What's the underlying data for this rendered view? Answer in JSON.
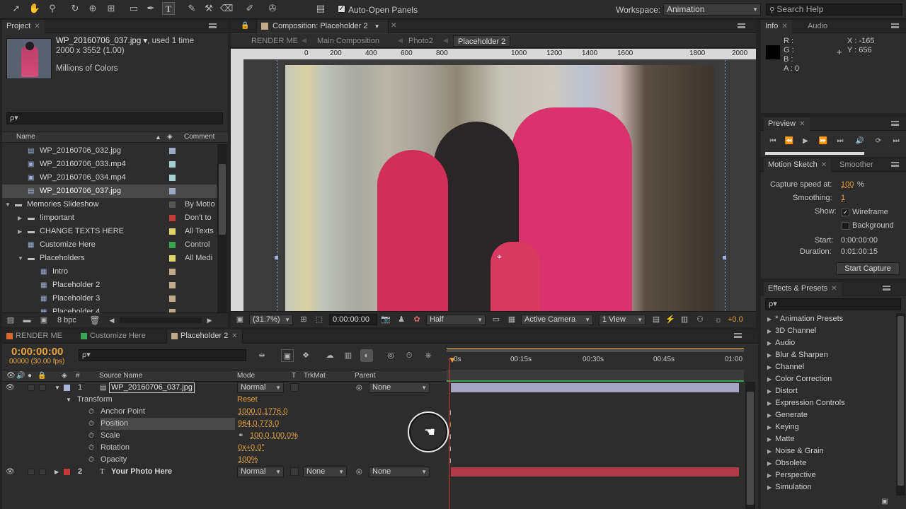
{
  "toolbar": {
    "auto_open_panels": "Auto-Open Panels",
    "workspace_label": "Workspace:",
    "workspace_value": "Animation",
    "search_placeholder": "Search Help"
  },
  "project": {
    "tab": "Project",
    "file_name": "WP_20160706_037.jpg ▾",
    "used": ", used 1 time",
    "dimensions": "2000 x 3552 (1.00)",
    "colors": "Millions of Colors",
    "search_placeholder": "ρ▾",
    "col_name": "Name",
    "col_comment": "Comment",
    "items": [
      {
        "name": "WP_20160706_032.jpg",
        "comment": "",
        "color": "#9aa9c4",
        "indent": 1,
        "type": "image"
      },
      {
        "name": "WP_20160706_033.mp4",
        "comment": "",
        "color": "#a6cfd0",
        "indent": 1,
        "type": "video"
      },
      {
        "name": "WP_20160706_034.mp4",
        "comment": "",
        "color": "#a6cfd0",
        "indent": 1,
        "type": "video"
      },
      {
        "name": "WP_20160706_037.jpg",
        "comment": "",
        "color": "#9aa9c4",
        "indent": 1,
        "type": "image",
        "selected": true
      },
      {
        "name": "Memories Slideshow",
        "comment": "By Motio",
        "color": "#555555",
        "indent": 0,
        "type": "folder",
        "expanded": true
      },
      {
        "name": "!important",
        "comment": "Don't to",
        "color": "#c03c3c",
        "indent": 1,
        "type": "folder"
      },
      {
        "name": "CHANGE TEXTS HERE",
        "comment": "All Texts",
        "color": "#e2d36a",
        "indent": 1,
        "type": "folder"
      },
      {
        "name": "Customize Here",
        "comment": "Control",
        "color": "#3aa651",
        "indent": 1,
        "type": "comp"
      },
      {
        "name": "Placeholders",
        "comment": "All Medi",
        "color": "#e2d36a",
        "indent": 1,
        "type": "folder",
        "expanded": true
      },
      {
        "name": "Intro",
        "comment": "",
        "color": "#c2a98a",
        "indent": 2,
        "type": "comp"
      },
      {
        "name": "Placeholder 2",
        "comment": "",
        "color": "#c2a98a",
        "indent": 2,
        "type": "comp"
      },
      {
        "name": "Placeholder 3",
        "comment": "",
        "color": "#c2a98a",
        "indent": 2,
        "type": "comp"
      },
      {
        "name": "Placeholder 4",
        "comment": "",
        "color": "#c2a98a",
        "indent": 2,
        "type": "comp"
      }
    ],
    "bpc": "8 bpc"
  },
  "composition": {
    "tab": "Composition: Placeholder 2",
    "breadcrumbs": [
      "RENDER ME",
      "Main Composition",
      "Photo2",
      "Placeholder 2"
    ],
    "ruler": [
      "0",
      "200",
      "400",
      "600",
      "800",
      "1000",
      "1200",
      "1400",
      "1600",
      "1800",
      "2000"
    ],
    "zoom": "(31.7%)",
    "timecode": "0:00:00:00",
    "resolution": "Half",
    "camera": "Active Camera",
    "views": "1 View",
    "exposure": "+0.0"
  },
  "info": {
    "tab": "Info",
    "tab2": "Audio",
    "r": "R :",
    "g": "G :",
    "b": "B :",
    "a": "A : 0",
    "x": "X : -165",
    "y": "Y : 656"
  },
  "preview": {
    "tab": "Preview"
  },
  "motion_sketch": {
    "tab": "Motion Sketch",
    "tab2": "Smoother",
    "capture_label": "Capture speed at:",
    "capture_value": "100",
    "capture_unit": "%",
    "smoothing_label": "Smoothing:",
    "smoothing_value": "1",
    "show_label": "Show:",
    "wireframe": "Wireframe",
    "background": "Background",
    "start_label": "Start:",
    "start_value": "0:00:00:00",
    "duration_label": "Duration:",
    "duration_value": "0:01:00:15",
    "start_capture": "Start Capture"
  },
  "effects": {
    "tab": "Effects & Presets",
    "search_placeholder": "ρ▾",
    "items": [
      "* Animation Presets",
      "3D Channel",
      "Audio",
      "Blur & Sharpen",
      "Channel",
      "Color Correction",
      "Distort",
      "Expression Controls",
      "Generate",
      "Keying",
      "Matte",
      "Noise & Grain",
      "Obsolete",
      "Perspective",
      "Simulation"
    ]
  },
  "timeline": {
    "tabs": [
      {
        "label": "RENDER ME",
        "color": "#d9682f"
      },
      {
        "label": "Customize Here",
        "color": "#3aa651"
      },
      {
        "label": "Placeholder 2",
        "color": "#c2a98a"
      }
    ],
    "timecode": "0:00:00:00",
    "frames": "00000 (30.00 fps)",
    "search_placeholder": "ρ▾",
    "cols": {
      "source": "Source Name",
      "mode": "Mode",
      "t": "T",
      "trkmat": "TrkMat",
      "parent": "Parent"
    },
    "ruler": [
      "0s",
      "00:15s",
      "00:30s",
      "00:45s",
      "01:00"
    ],
    "layers": [
      {
        "num": "1",
        "name": "WP_20160706_037.jpg",
        "mode": "Normal",
        "trkmat": "",
        "parent": "None",
        "color": "#a8b4d8"
      },
      {
        "num": "2",
        "name": "Your Photo Here",
        "mode": "Normal",
        "trkmat": "None",
        "parent": "None",
        "color": "#c43a3a"
      }
    ],
    "transform": {
      "label": "Transform",
      "reset": "Reset",
      "props": [
        {
          "name": "Anchor Point",
          "value": "1000.0,1776.0"
        },
        {
          "name": "Position",
          "value": "964.0,773.0"
        },
        {
          "name": "Scale",
          "value": "100.0,100.0%"
        },
        {
          "name": "Rotation",
          "value": "0x+0.0°"
        },
        {
          "name": "Opacity",
          "value": "100%"
        }
      ]
    }
  }
}
